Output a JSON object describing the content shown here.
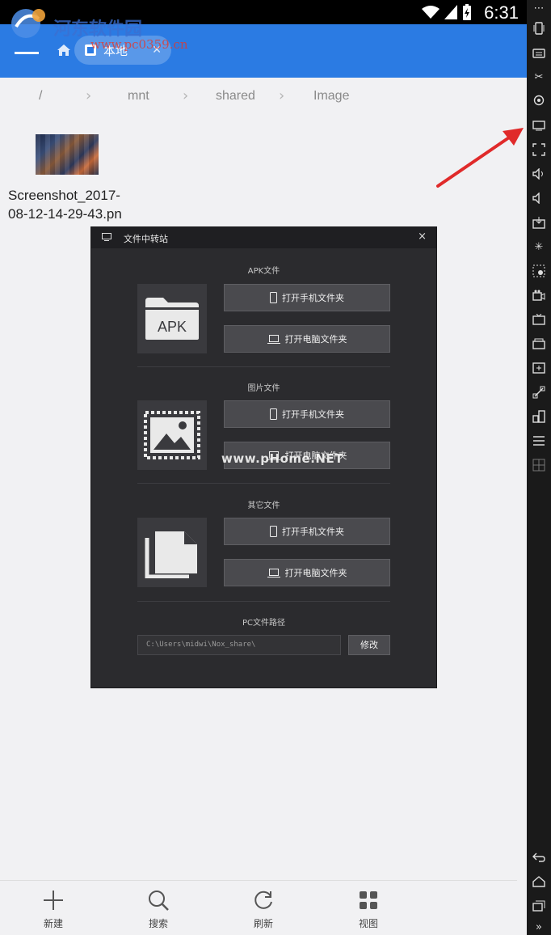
{
  "status_bar": {
    "time": "6:31"
  },
  "header": {
    "watermark_text": "河东软件园",
    "watermark_url": "www.pc0359.cn",
    "tab_label": "本地",
    "tab_close": "✕"
  },
  "breadcrumb": {
    "items": [
      "/",
      "mnt",
      "shared",
      "Image"
    ]
  },
  "file": {
    "name": "Screenshot_2017-08-12-14-29-43.pn"
  },
  "dialog": {
    "title": "文件中转站",
    "close": "×",
    "sections": [
      {
        "title": "APK文件",
        "icon_text": "APK",
        "icon": "folder-apk-icon"
      },
      {
        "title": "图片文件",
        "icon": "image-icon"
      },
      {
        "title": "其它文件",
        "icon": "files-icon"
      }
    ],
    "open_phone_folder": "打开手机文件夹",
    "open_pc_folder": "打开电脑文件夹",
    "pc_path_label": "PC文件路径",
    "pc_path_value": "C:\\Users\\midwi\\Nox_share\\",
    "edit_label": "修改",
    "watermark": "www.pHome.NET"
  },
  "bottom_bar": {
    "items": [
      {
        "label": "新建",
        "icon": "plus-icon"
      },
      {
        "label": "搜索",
        "icon": "search-icon"
      },
      {
        "label": "刷新",
        "icon": "refresh-icon"
      },
      {
        "label": "视图",
        "icon": "grid-view-icon"
      }
    ]
  },
  "sidebar": {
    "items": [
      "more",
      "shake",
      "keyboard",
      "screenshot",
      "location",
      "file-transfer",
      "fullscreen",
      "volume-up",
      "volume-down",
      "apk-install",
      "loading",
      "multi-select",
      "video",
      "tv",
      "app-store",
      "plus-box",
      "remote",
      "apps",
      "menu",
      "multi-instance",
      "back",
      "home",
      "recent",
      "expand"
    ]
  },
  "colors": {
    "header_blue": "#2b7be3",
    "dialog_bg": "#2b2b2e",
    "arrow_red": "#e02a2a"
  }
}
